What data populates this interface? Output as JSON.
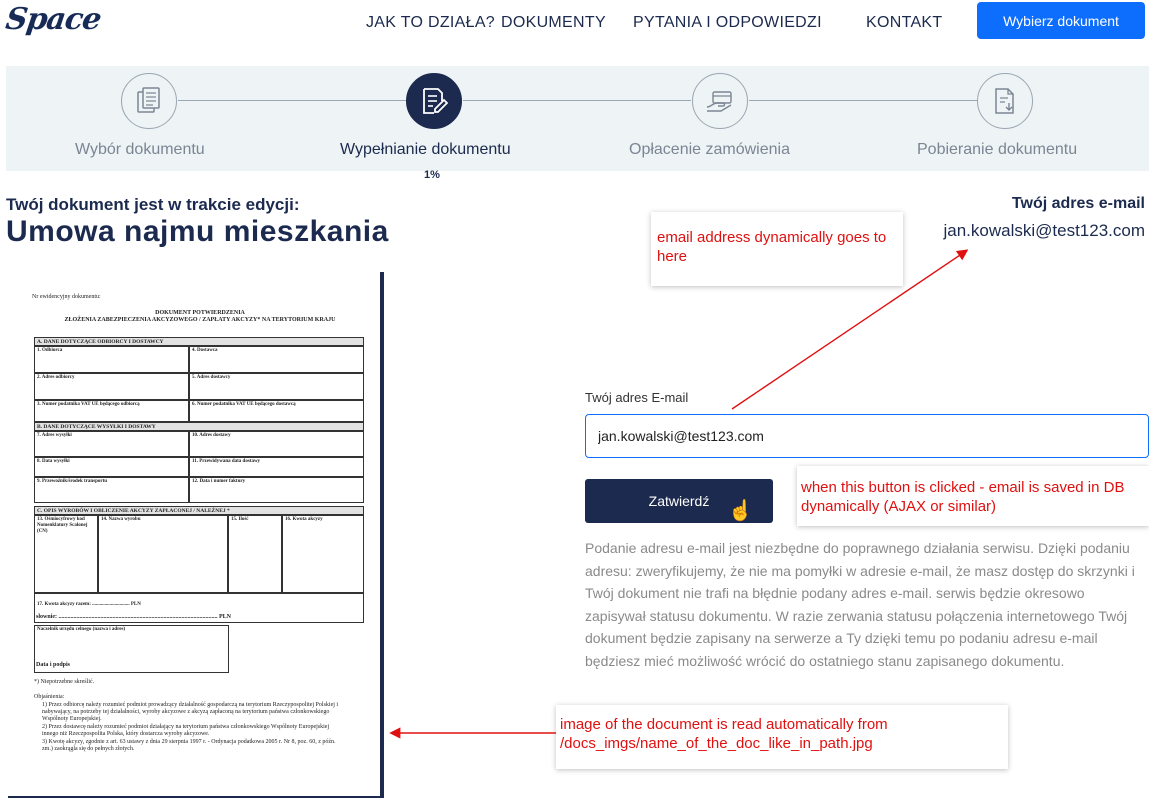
{
  "header": {
    "logo": "Space",
    "nav": [
      "JAK TO DZIAŁA?",
      "DOKUMENTY",
      "PYTANIA I ODPOWIEDZI",
      "KONTAKT"
    ],
    "cta": "Wybierz dokument"
  },
  "stepper": {
    "steps": [
      {
        "label": "Wybór dokumentu",
        "icon": "document-stack-icon"
      },
      {
        "label": "Wypełnianie dokumentu",
        "icon": "edit-document-icon"
      },
      {
        "label": "Opłacenie zamówienia",
        "icon": "payment-hand-icon"
      },
      {
        "label": "Pobieranie dokumentu",
        "icon": "download-document-icon"
      }
    ],
    "active_step": 2,
    "progress": "1%"
  },
  "document": {
    "subtitle": "Twój dokument jest w trakcie edycji:",
    "title": "Umowa najmu mieszkania"
  },
  "email_info": {
    "heading": "Twój adres e-mail",
    "value": "jan.kowalski@test123.com"
  },
  "form": {
    "label": "Twój adres E-mail",
    "value": "jan.kowalski@test123.com",
    "button": "Zatwierdź",
    "description": "Podanie adresu e-mail jest niezbędne do poprawnego działania serwisu. Dzięki podaniu adresu: zweryfikujemy, że nie ma pomyłki w adresie e-mail, że masz dostęp do skrzynki i Twój dokument nie trafi na błędnie podany adres e-mail. serwis będzie okresowo zapisywał  statusu dokumentu. W razie zerwania statusu połączenia internetowego Twój dokument będzie zapisany na serwerze a Ty dzięki temu po podaniu adresu e-mail będziesz mieć możliwość wrócić do ostatniego stanu zapisanego dokumentu."
  },
  "annotations": {
    "email_note": "email address dynamically goes to here",
    "button_note": "when this button is clicked - email is saved in DB dynamically (AJAX or similar)",
    "image_note": "image of the document is read automatically from /docs_imgs/name_of_the_doc_like_in_path.jpg"
  },
  "doc_preview": {
    "evid": "Nr ewidencyjny dokumentu:",
    "title1": "DOKUMENT POTWIERDZENIA",
    "title2": "ZŁOŻENIA ZABEZPIECZENIA AKCYZOWEGO / ZAPŁATY AKCYZY* NA TERYTORIUM KRAJU",
    "secA": "A. DANE DOTYCZĄCE ODBIORCY I DOSTAWCY",
    "a1": "1. Odbiorca",
    "a4": "4. Dostawca",
    "a2": "2. Adres odbiorcy",
    "a5": "5. Adres dostawcy",
    "a3": "3. Numer podatnika VAT UE będącego odbiorcą",
    "a6": "6. Numer podatnika VAT UE będącego dostawcą",
    "secB": "B. DANE DOTYCZĄCE WYSYŁKI I DOSTAWY",
    "b7": "7. Adres wysyłki",
    "b10": "10. Adres dostawy",
    "b8": "8. Data wysyłki",
    "b11": "11. Przewidywana data dostawy",
    "b9": "9. Przewoźnik/środek transportu",
    "b12": "12. Data i numer faktury",
    "secC": "C. OPIS WYROBÓW I OBLICZENIE AKCYZY ZAPŁACONEJ / NALEŻNEJ *",
    "c13": "13. Ośmiocyfrowy kod Nomenklatury Scalonej (CN)",
    "c14": "14. Nazwa wyrobu",
    "c15": "15. Ilość",
    "c16": "16. Kwota akcyzy",
    "c17": "17. Kwota akcyzy razem: .............................. PLN",
    "slownie": "słownie: .......................................................................................................... PLN",
    "naczelnik": "Naczelnik urzędu celnego (nazwa i adres)",
    "data": "Data i podpis",
    "star": "*) Niepotrzebne skreślić.",
    "objasnienia": "Objaśnienia:",
    "e1": "1) Przez odbiorcę należy rozumieć podmiot prowadzący działalność gospodarczą na terytorium Rzeczypospolitej Polskiej i nabywający, na potrzeby tej działalności, wyroby akcyzowe z akcyzą zapłaconą na terytorium państwa członkowskiego Wspólnoty Europejskiej.",
    "e2": "2) Przez dostawcę należy rozumieć podmiot działający na terytorium państwa członkowskiego Wspólnoty Europejskiej innego niż Rzeczpospolita Polska, który dostarcza wyroby akcyzowe.",
    "e3": "3) Kwotę akcyzy, zgodnie z art. 63 ustawy z dnia 29 sierpnia 1997 r. - Ordynacja podatkowa 2005 r. Nr 8, poz. 60, z późn. zm.) zaokrągla się do pełnych złotych."
  }
}
